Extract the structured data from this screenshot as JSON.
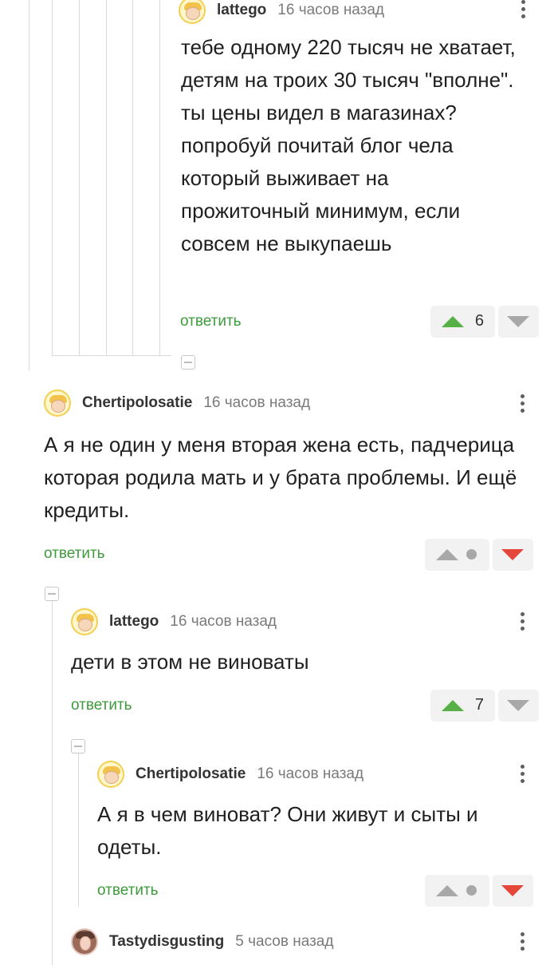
{
  "comments": [
    {
      "user": "lattego",
      "time": "16 часов назад",
      "text": "тебе одному 220 тысяч не хватает, детям на троих 30 тысяч \"вполне\". ты цены видел в магазинах? попробуй почитай блог чела который выживает на прожиточный минимум, если совсем не выкупаешь",
      "reply": "ответить",
      "rating": "6",
      "vote_state": "up"
    },
    {
      "user": "Chertipolosatie",
      "time": "16 часов назад",
      "text": "А я не один у меня вторая жена есть, падчерица которая родила мать и у брата проблемы. И ещё кредиты.",
      "reply": "ответить",
      "vote_state": "down"
    },
    {
      "user": "lattego",
      "time": "16 часов назад",
      "text": "дети в этом не виноваты",
      "reply": "ответить",
      "rating": "7",
      "vote_state": "up"
    },
    {
      "user": "Chertipolosatie",
      "time": "16 часов назад",
      "text": "А я в чем виноват? Они живут и сыты и одеты.",
      "reply": "ответить",
      "vote_state": "down"
    },
    {
      "user": "Tastydisgusting",
      "time": "5 часов назад"
    }
  ],
  "colors": {
    "reply_green": "#3e9b3c",
    "upvote_green": "#56b046",
    "downvote_red": "#e5463a",
    "neutral_grey": "#a8a8a8"
  },
  "icons": [
    "avatar-icon",
    "more-menu-icon",
    "upvote-icon",
    "downvote-icon",
    "collapse-icon"
  ]
}
